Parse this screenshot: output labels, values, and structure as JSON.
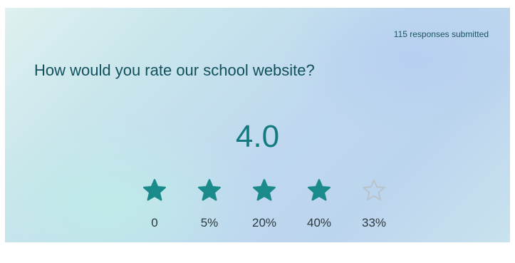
{
  "responses_text": "115 responses submitted",
  "question": "How would you rate our school website?",
  "average": "4.0",
  "average_rating": 4.0,
  "max_rating": 5,
  "colors": {
    "filled_star": "#1a8a8a",
    "empty_star": "#b9c2c8",
    "accent_text": "#137a80"
  },
  "stars": [
    {
      "icon": "filled-star-icon",
      "filled": true,
      "percent": "0"
    },
    {
      "icon": "filled-star-icon",
      "filled": true,
      "percent": "5%"
    },
    {
      "icon": "filled-star-icon",
      "filled": true,
      "percent": "20%"
    },
    {
      "icon": "filled-star-icon",
      "filled": true,
      "percent": "40%"
    },
    {
      "icon": "empty-star-icon",
      "filled": false,
      "percent": "33%"
    }
  ]
}
